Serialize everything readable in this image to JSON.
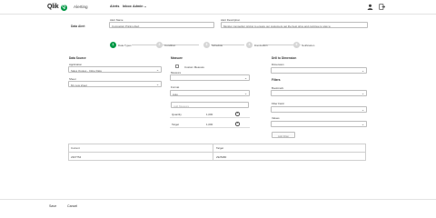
{
  "header": {
    "logo": "Qlik",
    "logo_q": "Q",
    "app_name": "Alerting",
    "nav": [
      "Alerts",
      "Inbox",
      "Admin"
    ],
    "admin_chevron": "⌄",
    "icons": [
      "user-icon",
      "logout-icon"
    ]
  },
  "alert": {
    "section_label": "Data Alert",
    "name_label": "Alert Name",
    "name_value": "Competitor Pricing Alert",
    "desc_label": "Alert Description",
    "desc_value": "Monitor competitor pricing to ensure our customers get the best price and continue to stay w"
  },
  "steps": [
    {
      "num": "1",
      "label": "Data Types",
      "active": true
    },
    {
      "num": "2",
      "label": "Condition",
      "active": false
    },
    {
      "num": "3",
      "label": "Schedule",
      "active": false
    },
    {
      "num": "4",
      "label": "Distribution",
      "active": false
    },
    {
      "num": "5",
      "label": "Notification",
      "active": false
    }
  ],
  "data_source": {
    "title": "Data Source",
    "app_label": "Application",
    "app_value": "Sales Quotes - Inline Data",
    "sheet_label": "Sheet",
    "sheet_value": "My new sheet"
  },
  "measure": {
    "title": "Measure",
    "custom_label": "Custom Measure",
    "measure_label": "Measure",
    "measure_value": "",
    "format_label": "Format",
    "format_value": "Auto",
    "add_placeholder": "Add Measure",
    "rows": [
      {
        "name": "Quantity",
        "value": "1,000"
      },
      {
        "name": "Target",
        "value": "1,000"
      }
    ],
    "plus": "+"
  },
  "drill": {
    "title": "Drill to Dimension",
    "dimension_label": "Dimension",
    "filters_title": "Filters",
    "bookmark_label": "Bookmark",
    "filter_field_label": "Filter Field",
    "values_label": "Values",
    "add_filter_label": "Add Filter"
  },
  "results": {
    "headers": [
      "Current",
      "Target"
    ],
    "values": [
      "2307754",
      "2925480"
    ]
  },
  "footer": {
    "save": "Save",
    "cancel": "Cancel"
  },
  "colors": {
    "accent": "#009845"
  }
}
